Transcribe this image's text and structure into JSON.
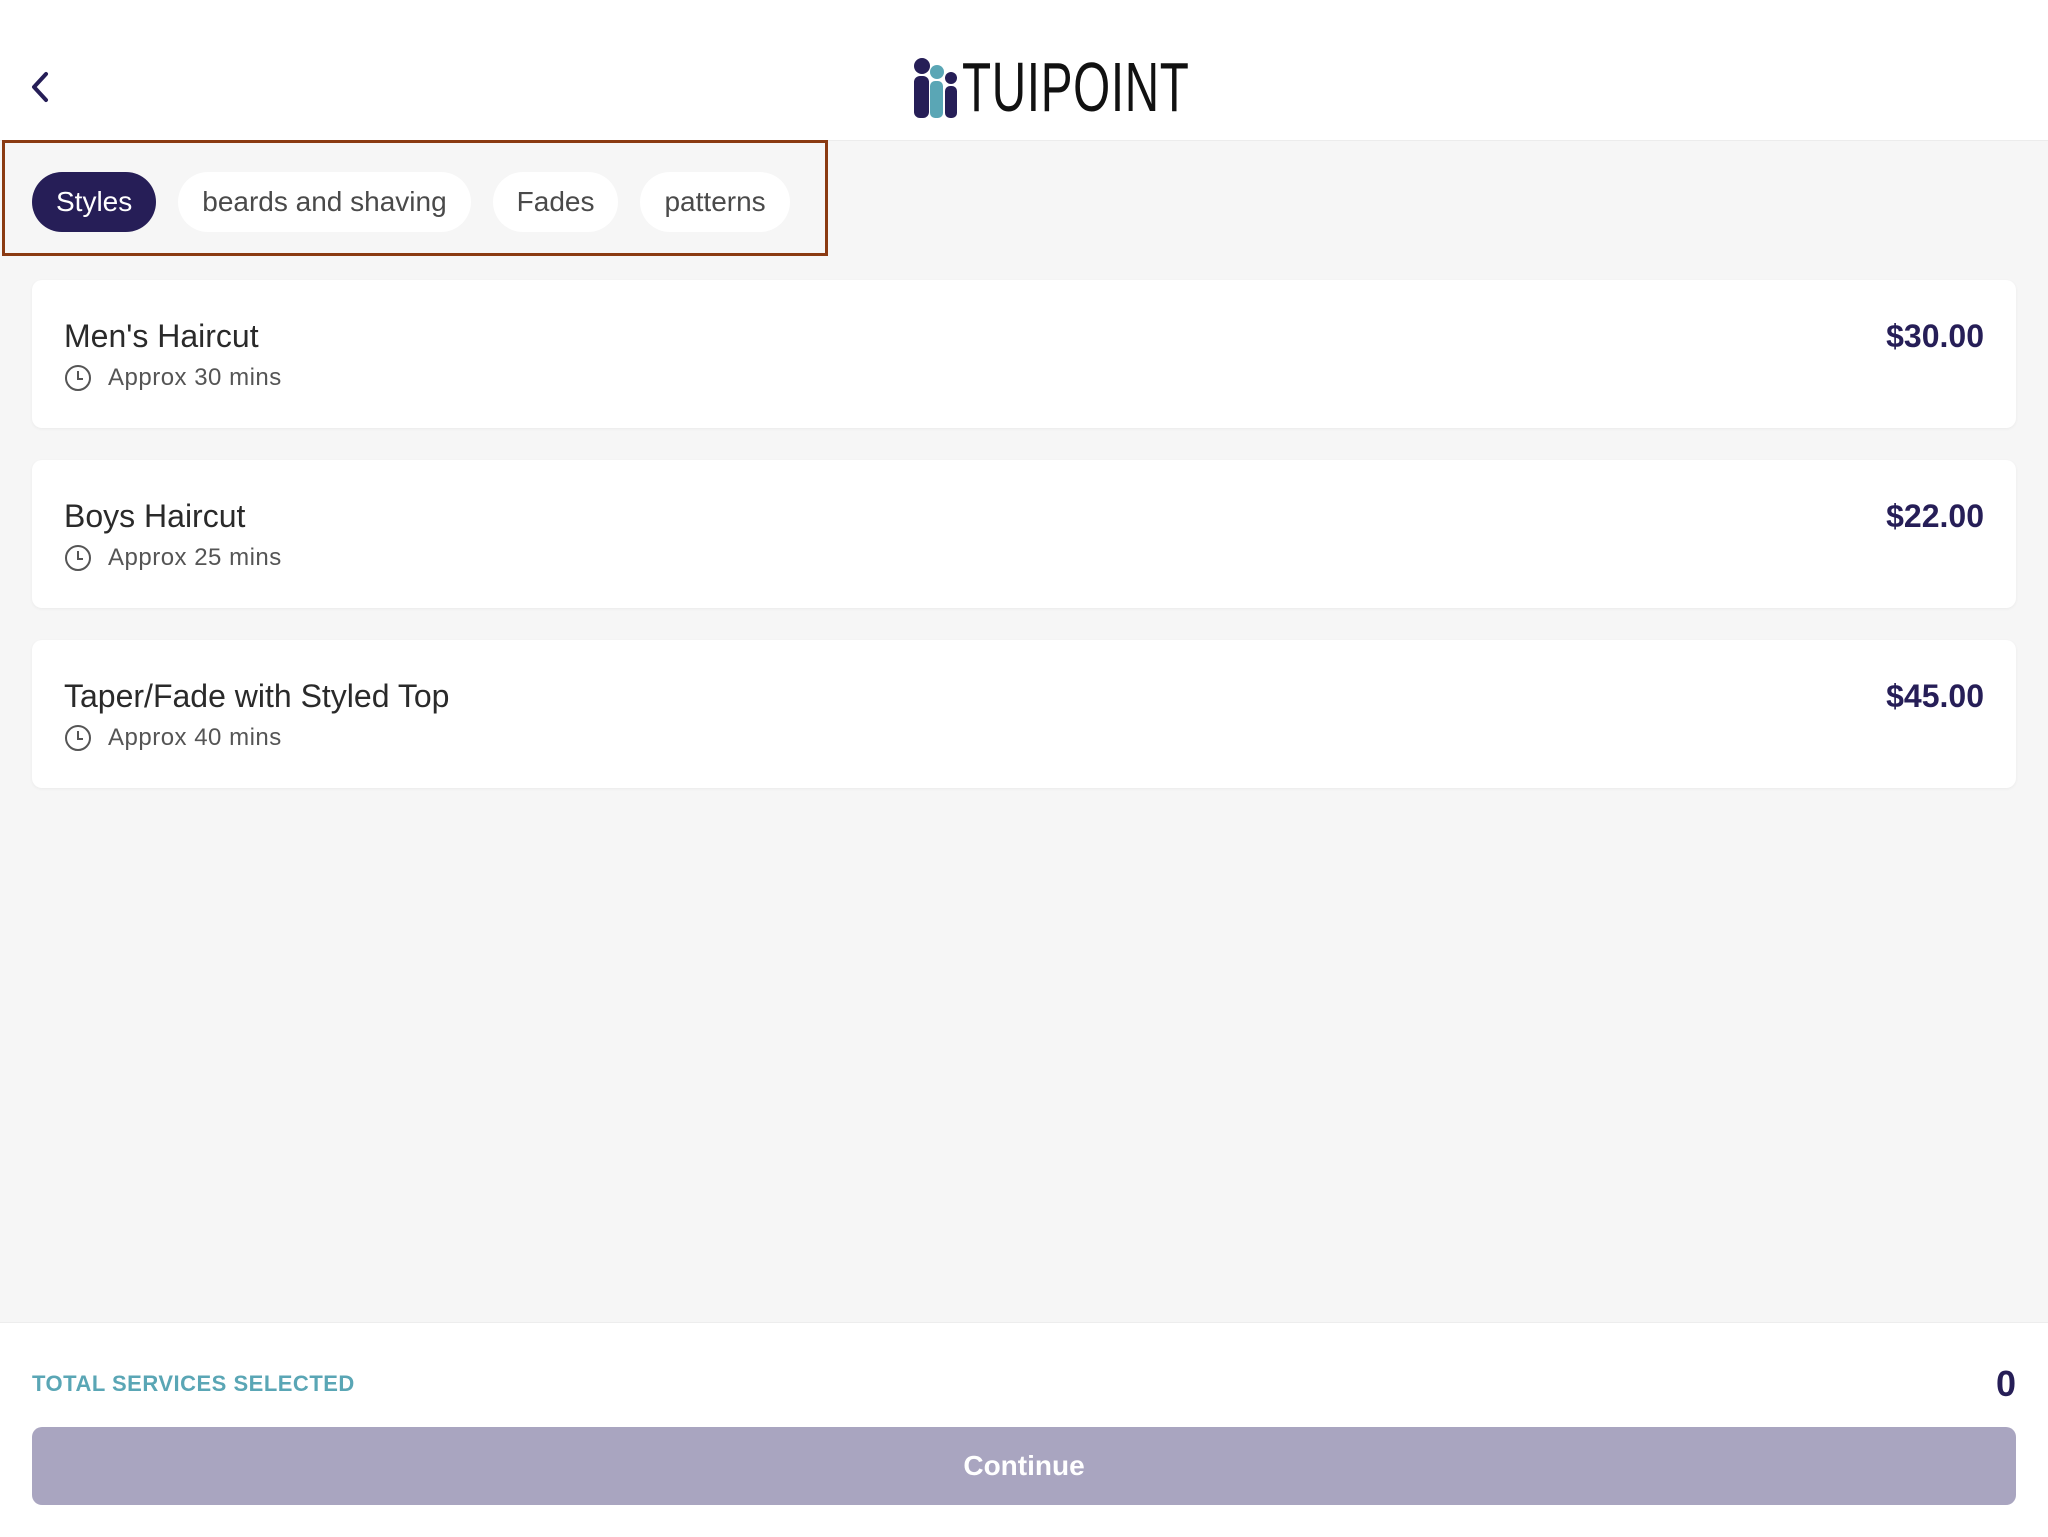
{
  "header": {
    "brand": "TUIPOINT",
    "back_icon": "chevron-left-icon"
  },
  "tabs": [
    {
      "label": "Styles",
      "active": true
    },
    {
      "label": "beards and shaving",
      "active": false
    },
    {
      "label": "Fades",
      "active": false
    },
    {
      "label": "patterns",
      "active": false
    }
  ],
  "services": [
    {
      "name": "Men's Haircut",
      "duration": "Approx 30 mins",
      "price": "$30.00"
    },
    {
      "name": "Boys Haircut",
      "duration": "Approx 25 mins",
      "price": "$22.00"
    },
    {
      "name": "Taper/Fade with Styled Top",
      "duration": "Approx 40 mins",
      "price": "$45.00"
    }
  ],
  "footer": {
    "total_label": "TOTAL SERVICES SELECTED",
    "total_count": "0",
    "continue_label": "Continue"
  },
  "colors": {
    "primary": "#261e57",
    "accent": "#5aa6b5",
    "disabled_button": "#a9a5c0",
    "highlight_border": "#8a3a12"
  }
}
